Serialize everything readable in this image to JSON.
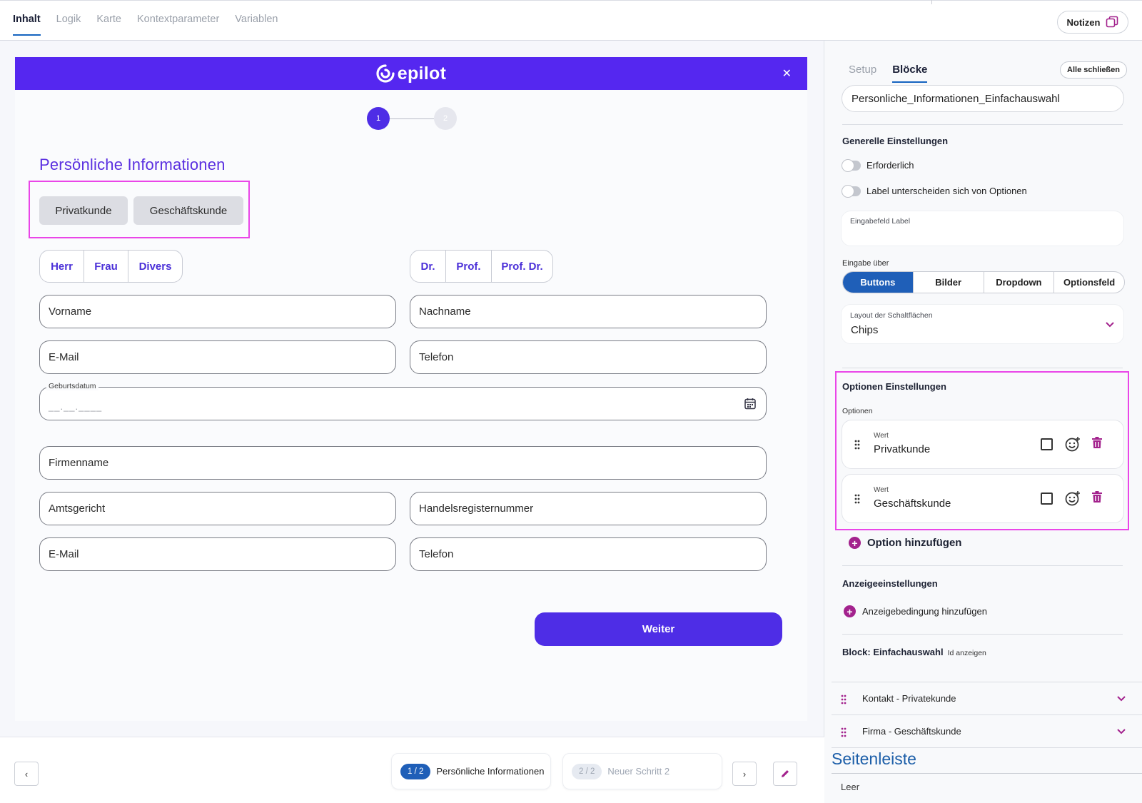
{
  "top_tabs": [
    "Inhalt",
    "Logik",
    "Karte",
    "Kontextparameter",
    "Variablen"
  ],
  "notes_button": "Notizen",
  "form": {
    "brand": "epilot",
    "steps": [
      "1",
      "2"
    ],
    "title": "Persönliche Informationen",
    "customer_type_options": [
      "Privatkunde",
      "Geschäftskunde"
    ],
    "salutation_options": [
      "Herr",
      "Frau",
      "Divers"
    ],
    "title_options": [
      "Dr.",
      "Prof.",
      "Prof. Dr."
    ],
    "fields": {
      "first_name": "Vorname",
      "last_name": "Nachname",
      "email": "E-Mail",
      "phone": "Telefon",
      "birthdate_label": "Geburtsdatum",
      "birthdate_placeholder": "__.__.____",
      "company": "Firmenname",
      "court": "Amtsgericht",
      "register_number": "Handelsregisternummer",
      "email2": "E-Mail",
      "phone2": "Telefon"
    },
    "next_button": "Weiter"
  },
  "bottom_nav": {
    "step1_badge": "1 / 2",
    "step1_label": "Persönliche Informationen",
    "step2_badge": "2 / 2",
    "step2_label": "Neuer Schritt 2"
  },
  "panel": {
    "tabs": [
      "Setup",
      "Blöcke"
    ],
    "close_all": "Alle schließen",
    "block_name": "Personliche_Informationen_Einfachauswahl",
    "general_title": "Generelle Einstellungen",
    "toggle_required": "Erforderlich",
    "toggle_label_diff": "Label unterscheiden sich von Optionen",
    "input_label_title": "Eingabefeld Label",
    "input_via_title": "Eingabe über",
    "input_via_options": [
      "Buttons",
      "Bilder",
      "Dropdown",
      "Optionsfeld"
    ],
    "input_via_selected": "Buttons",
    "layout_label": "Layout der Schaltflächen",
    "layout_value": "Chips",
    "options_title": "Optionen Einstellungen",
    "options_label": "Optionen",
    "value_label": "Wert",
    "options": [
      "Privatkunde",
      "Geschäftskunde"
    ],
    "add_option": "Option hinzufügen",
    "display_title": "Anzeigeeinstellungen",
    "add_condition": "Anzeigebedingung hinzufügen",
    "block_label": "Block: Einfachauswahl",
    "show_id": "Id anzeigen",
    "accordions": [
      "Kontakt - Privatekunde",
      "Firma - Geschäftskunde"
    ],
    "sidebar_title": "Seitenleiste",
    "sidebar_empty": "Leer"
  },
  "colors": {
    "brand_purple": "#5527f0",
    "accent_blue": "#1f5fb8",
    "highlight_pink": "#ea46e8",
    "delete_magenta": "#a3228d"
  }
}
